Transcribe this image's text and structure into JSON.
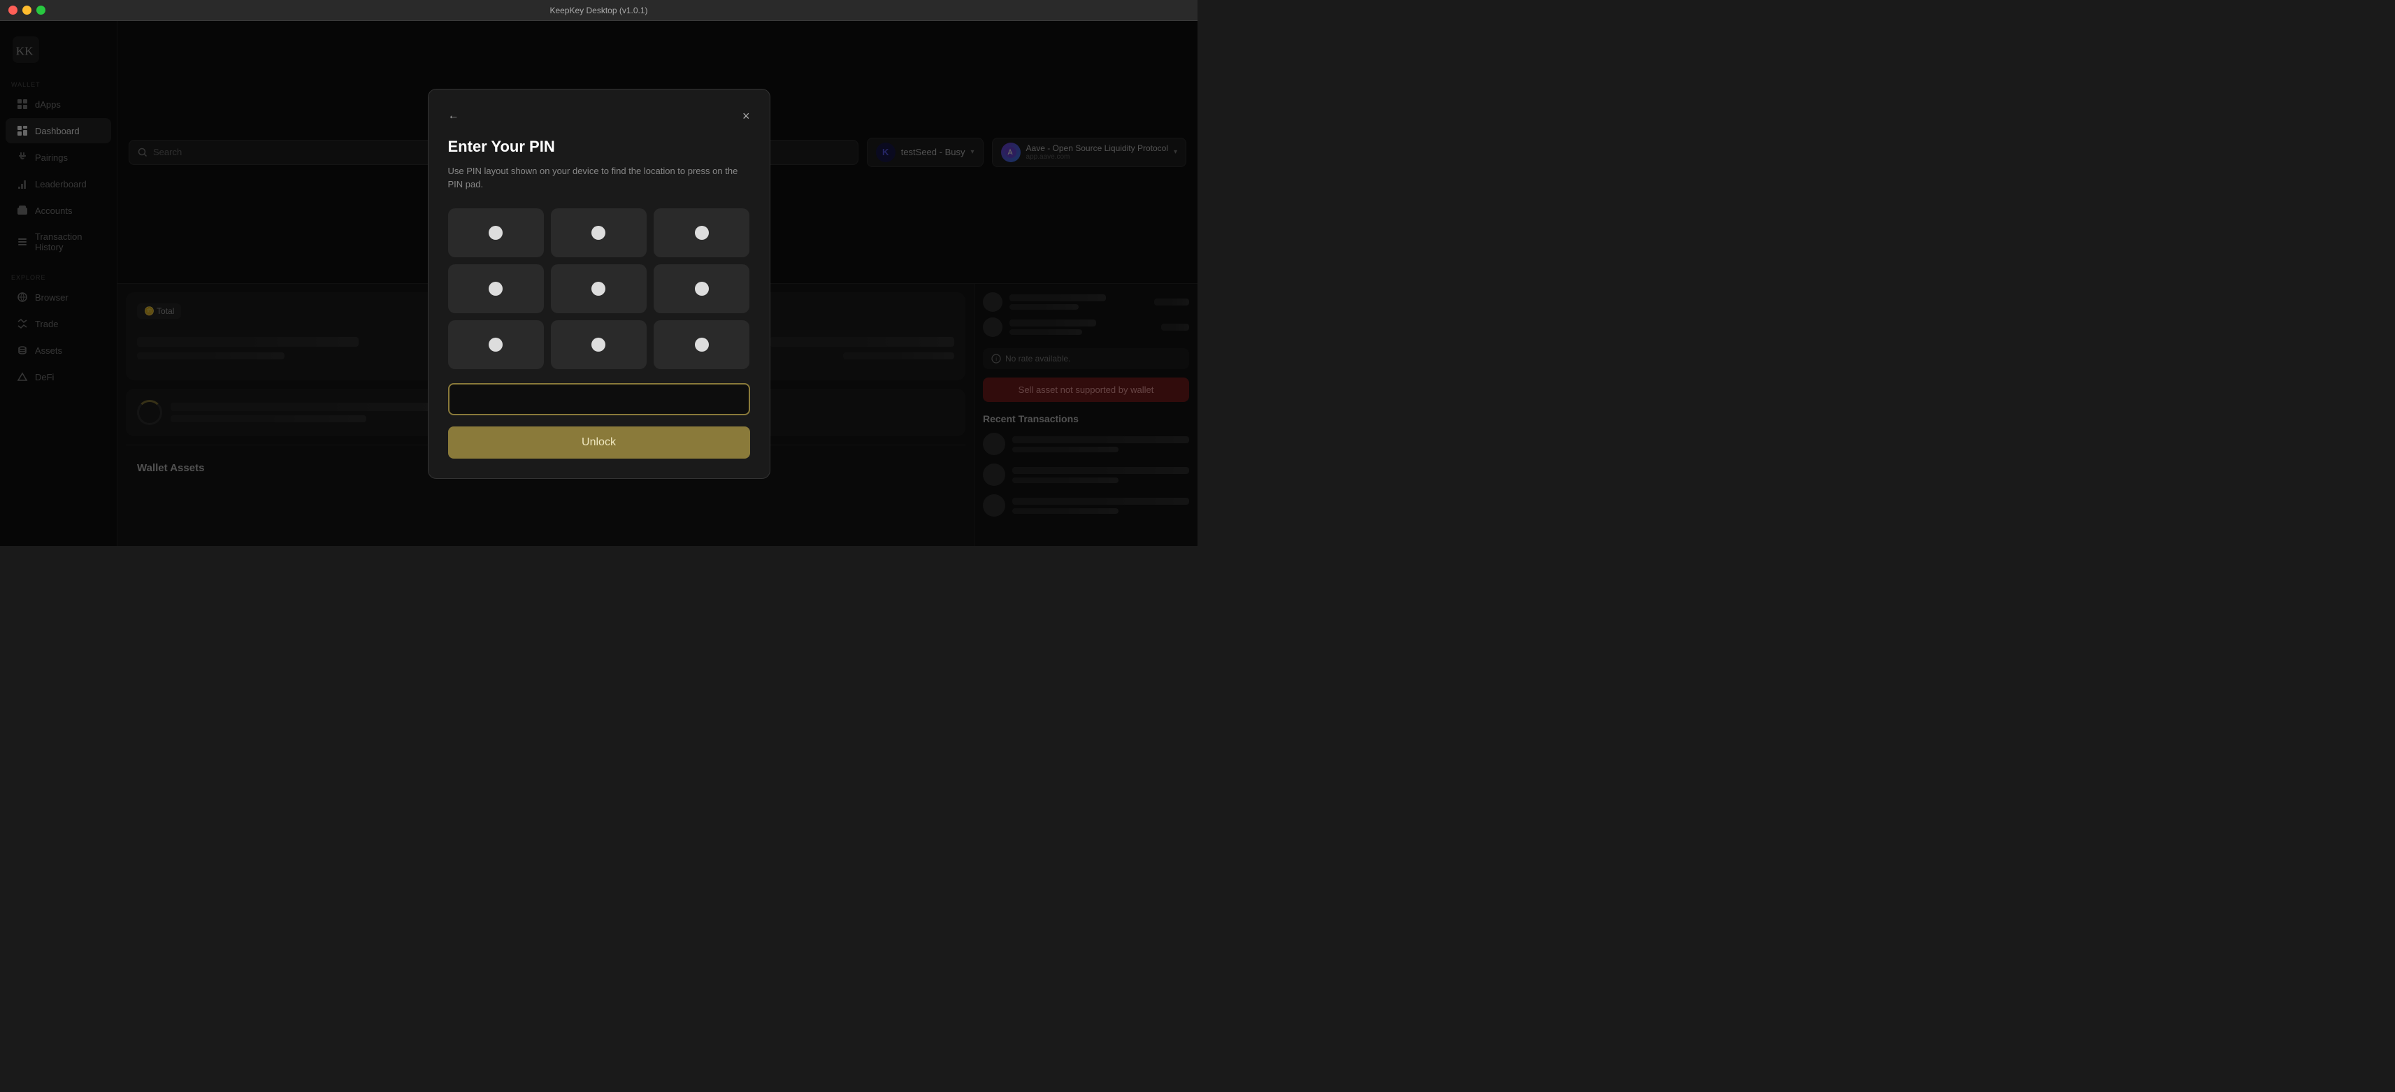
{
  "titlebar": {
    "title": "KeepKey Desktop (v1.0.1)"
  },
  "sidebar": {
    "wallet_label": "WALLET",
    "explore_label": "EXPLORE",
    "items_wallet": [
      {
        "id": "dapps",
        "label": "dApps",
        "icon": "grid-icon"
      },
      {
        "id": "dashboard",
        "label": "Dashboard",
        "icon": "dashboard-icon",
        "active": true
      },
      {
        "id": "pairings",
        "label": "Pairings",
        "icon": "plug-icon"
      },
      {
        "id": "leaderboard",
        "label": "Leaderboard",
        "icon": "chart-icon"
      },
      {
        "id": "accounts",
        "label": "Accounts",
        "icon": "wallet-icon"
      },
      {
        "id": "transaction-history",
        "label": "Transaction History",
        "icon": "list-icon"
      }
    ],
    "items_explore": [
      {
        "id": "browser",
        "label": "Browser",
        "icon": "globe-icon"
      },
      {
        "id": "trade",
        "label": "Trade",
        "icon": "trade-icon"
      },
      {
        "id": "assets",
        "label": "Assets",
        "icon": "assets-icon"
      },
      {
        "id": "defi",
        "label": "DeFi",
        "icon": "defi-icon"
      }
    ]
  },
  "header": {
    "search_placeholder": "Search",
    "wallet_name": "testSeed - Busy",
    "wallet_initial": "K",
    "dapp_name": "Aave - Open Source Liquidity Protocol",
    "dapp_url": "app.aave.com"
  },
  "dashboard": {
    "total_label": "🪙 Total",
    "wallet_assets_label": "Wallet Assets"
  },
  "right_panel": {
    "no_rate_label": "No rate available.",
    "sell_btn_label": "Sell asset not supported by wallet",
    "recent_tx_title": "Recent Transactions"
  },
  "modal": {
    "title": "Enter Your PIN",
    "subtitle": "Use PIN layout shown on your device to find the location to press on the PIN pad.",
    "pin_placeholder": "",
    "unlock_label": "Unlock",
    "back_icon": "←",
    "close_icon": "×"
  }
}
